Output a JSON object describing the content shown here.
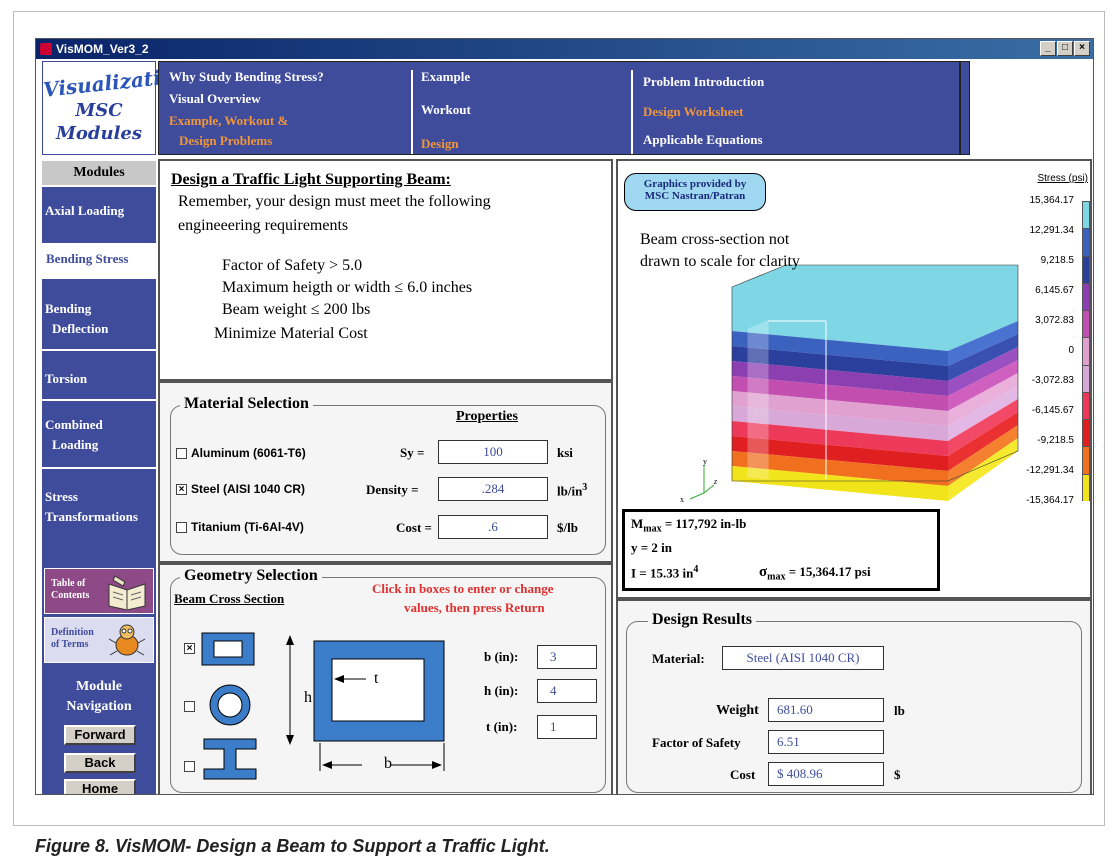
{
  "window": {
    "title": "VisMOM_Ver3_2"
  },
  "logo": {
    "line1": "Visualization",
    "line2": "MSC",
    "line3": "Modules"
  },
  "topnav": {
    "col1": [
      "Why Study Bending Stress?",
      "Visual Overview",
      "Example, Workout &",
      "Design Problems"
    ],
    "col2": [
      "Example",
      "Workout",
      "Design"
    ],
    "col3": [
      "Problem Introduction",
      "Design Worksheet",
      "Applicable Equations"
    ]
  },
  "sidebar": {
    "header": "Modules",
    "items": [
      "Axial Loading",
      "Bending Stress",
      "Bending",
      "Deflection",
      "Torsion",
      "Combined",
      "Loading",
      "Stress",
      "Transformations"
    ],
    "toc": [
      "Table of",
      "Contents"
    ],
    "def": [
      "Definition",
      "of Terms"
    ],
    "nav_title": [
      "Module",
      "Navigation"
    ],
    "buttons": [
      "Forward",
      "Back",
      "Home"
    ]
  },
  "design": {
    "title": "Design a Traffic Light Supporting Beam:",
    "intro1": "Remember, your design must meet the following",
    "intro2": "engineeering requirements",
    "reqs": [
      "Factor of Safety > 5.0",
      "Maximum heigth or width ≤ 6.0 inches",
      "Beam weight ≤ 200 lbs",
      "Minimize Material Cost"
    ]
  },
  "material": {
    "title": "Material Selection",
    "props_header": "Properties",
    "options": [
      {
        "label": "Aluminum (6061-T6)",
        "checked": false
      },
      {
        "label": "Steel (AISI 1040 CR)",
        "checked": true
      },
      {
        "label": "Titanium (Ti-6Al-4V)",
        "checked": false
      }
    ],
    "props": [
      {
        "name": "Sy =",
        "value": "100",
        "unit": "ksi"
      },
      {
        "name": "Density =",
        "value": ".284",
        "unit": "lb/in",
        "sup": "3"
      },
      {
        "name": "Cost =",
        "value": ".6",
        "unit": "$/lb"
      }
    ]
  },
  "geometry": {
    "title": "Geometry Selection",
    "subtitle": "Beam Cross Section",
    "hint1": "Click in boxes to enter or change",
    "hint2": "values, then press Return",
    "dims": [
      {
        "name": "b (in):",
        "value": "3"
      },
      {
        "name": "h (in):",
        "value": "4"
      },
      {
        "name": "t (in):",
        "value": "1"
      }
    ],
    "diagram": {
      "t": "t",
      "h": "h",
      "b": "b"
    },
    "selected_shape": "rectangular-tube"
  },
  "graphics": {
    "credit1": "Graphics provided by",
    "credit2": "MSC Nastran/Patran",
    "note1": "Beam cross-section not",
    "note2": "drawn to scale for clarity",
    "axis_y": "y",
    "axis_x": "x",
    "axis_z": "z",
    "stress_title": "Stress (psi)",
    "ticks": [
      "15,364.17",
      "12,291.34",
      "9,218.5",
      "6,145.67",
      "3,072.83",
      "0",
      "-3,072.83",
      "-6,145.67",
      "-9,218.5",
      "-12,291.34",
      "-15,364.17"
    ],
    "colors": [
      "#7fd7e6",
      "#3c62c0",
      "#2b3f9c",
      "#8b3fb0",
      "#c24fb0",
      "#e0a0d0",
      "#d8a8d8",
      "#ee3a5a",
      "#e02020",
      "#f07020",
      "#f2e41a"
    ]
  },
  "equations": {
    "mmax": "M",
    "mmax_sub": "max",
    "mmax_val": " = 117,792 in-lb",
    "y": "y = 2 in",
    "i": "I = 15.33 in",
    "i_sup": "4",
    "smax": "σ",
    "smax_sub": "max",
    "smax_val": " = 15,364.17 psi"
  },
  "results": {
    "title": "Design Results",
    "material_label": "Material:",
    "material_value": "Steel (AISI 1040 CR)",
    "rows": [
      {
        "label": "Weight",
        "value": "681.60",
        "unit": "lb"
      },
      {
        "label": "Factor of Safety",
        "value": "6.51",
        "unit": ""
      },
      {
        "label": "Cost",
        "value": "$ 408.96",
        "unit": "$"
      }
    ]
  },
  "caption": "Figure 8. VisMOM- Design a Beam to Support a Traffic Light."
}
